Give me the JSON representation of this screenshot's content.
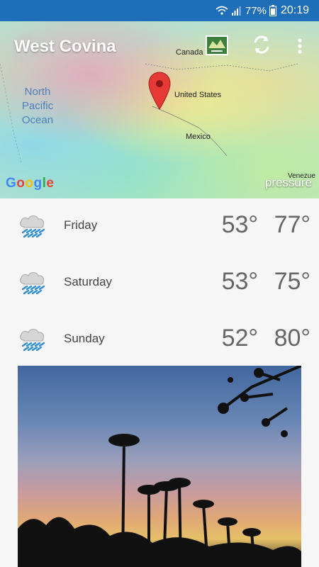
{
  "status_bar": {
    "battery": "77%",
    "time": "20:19"
  },
  "map": {
    "location": "West Covina",
    "ocean_label": "North Pacific Ocean",
    "labels": {
      "canada": "Canada",
      "us": "United States",
      "mexico": "Mexico",
      "venezuela": "Venezue"
    },
    "google": "Google",
    "overlay": "pressure"
  },
  "forecast": [
    {
      "day": "Friday",
      "low": "53°",
      "high": "77°",
      "icon": "rain-cloud-icon"
    },
    {
      "day": "Saturday",
      "low": "53°",
      "high": "75°",
      "icon": "rain-cloud-icon"
    },
    {
      "day": "Sunday",
      "low": "52°",
      "high": "80°",
      "icon": "rain-cloud-icon"
    }
  ],
  "colors": {
    "status_bar": "#1f6fb8",
    "pin": "#e53935",
    "rain": "#2f8fd6"
  }
}
